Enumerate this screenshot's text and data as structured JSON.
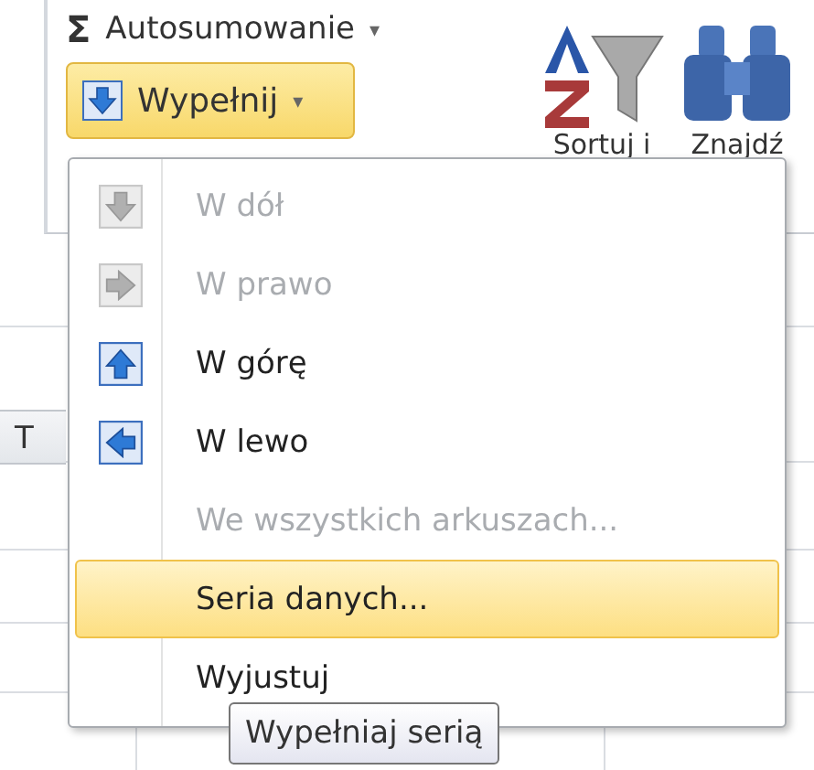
{
  "ribbon": {
    "autosum": {
      "icon": "Σ",
      "label": "Autosumowanie",
      "caret": "▾"
    },
    "fill_button": {
      "label": "Wypełnij",
      "caret": "▾",
      "open": true
    },
    "sort": {
      "label": "Sortuj i"
    },
    "find": {
      "label": "Znajdź"
    }
  },
  "sheet": {
    "column_header": "T"
  },
  "menu": {
    "items": [
      {
        "label": "W dół",
        "kind": "down",
        "disabled": true,
        "selected": false
      },
      {
        "label": "W prawo",
        "kind": "right",
        "disabled": true,
        "selected": false
      },
      {
        "label": "W górę",
        "kind": "up",
        "disabled": false,
        "selected": false
      },
      {
        "label": "W lewo",
        "kind": "left",
        "disabled": false,
        "selected": false
      },
      {
        "label": "We wszystkich arkuszach...",
        "kind": "plain",
        "disabled": true,
        "selected": false
      },
      {
        "label": "Seria danych...",
        "kind": "plain",
        "disabled": false,
        "selected": true
      },
      {
        "label": "Wyjustuj",
        "kind": "plain",
        "disabled": false,
        "selected": false
      }
    ]
  },
  "tooltip": {
    "text": "Wypełniaj serią"
  }
}
